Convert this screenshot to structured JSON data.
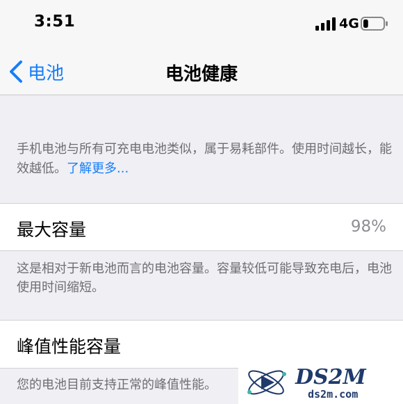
{
  "status_bar": {
    "time": "3:51",
    "network": "4G",
    "battery_level": 0.25,
    "signal_bars": 4
  },
  "nav": {
    "back_label": "电池",
    "title": "电池健康"
  },
  "intro": {
    "text": "手机电池与所有可充电电池类似，属于易耗部件。使用时间越长，能效越低。",
    "learn_more": "了解更多..."
  },
  "max_capacity": {
    "label": "最大容量",
    "value": "98%",
    "note": "这是相对于新电池而言的电池容量。容量较低可能导致充电后，电池使用时间缩短。"
  },
  "peak_performance": {
    "label": "峰值性能容量",
    "note": "您的电池目前支持正常的峰值性能。"
  },
  "watermark": {
    "brand": "DS2M",
    "domain": "ds2m.com"
  },
  "colors": {
    "accent": "#157efb",
    "background": "#efeff4",
    "secondary_text": "#6d6d72",
    "value_text": "#8e8e93"
  }
}
